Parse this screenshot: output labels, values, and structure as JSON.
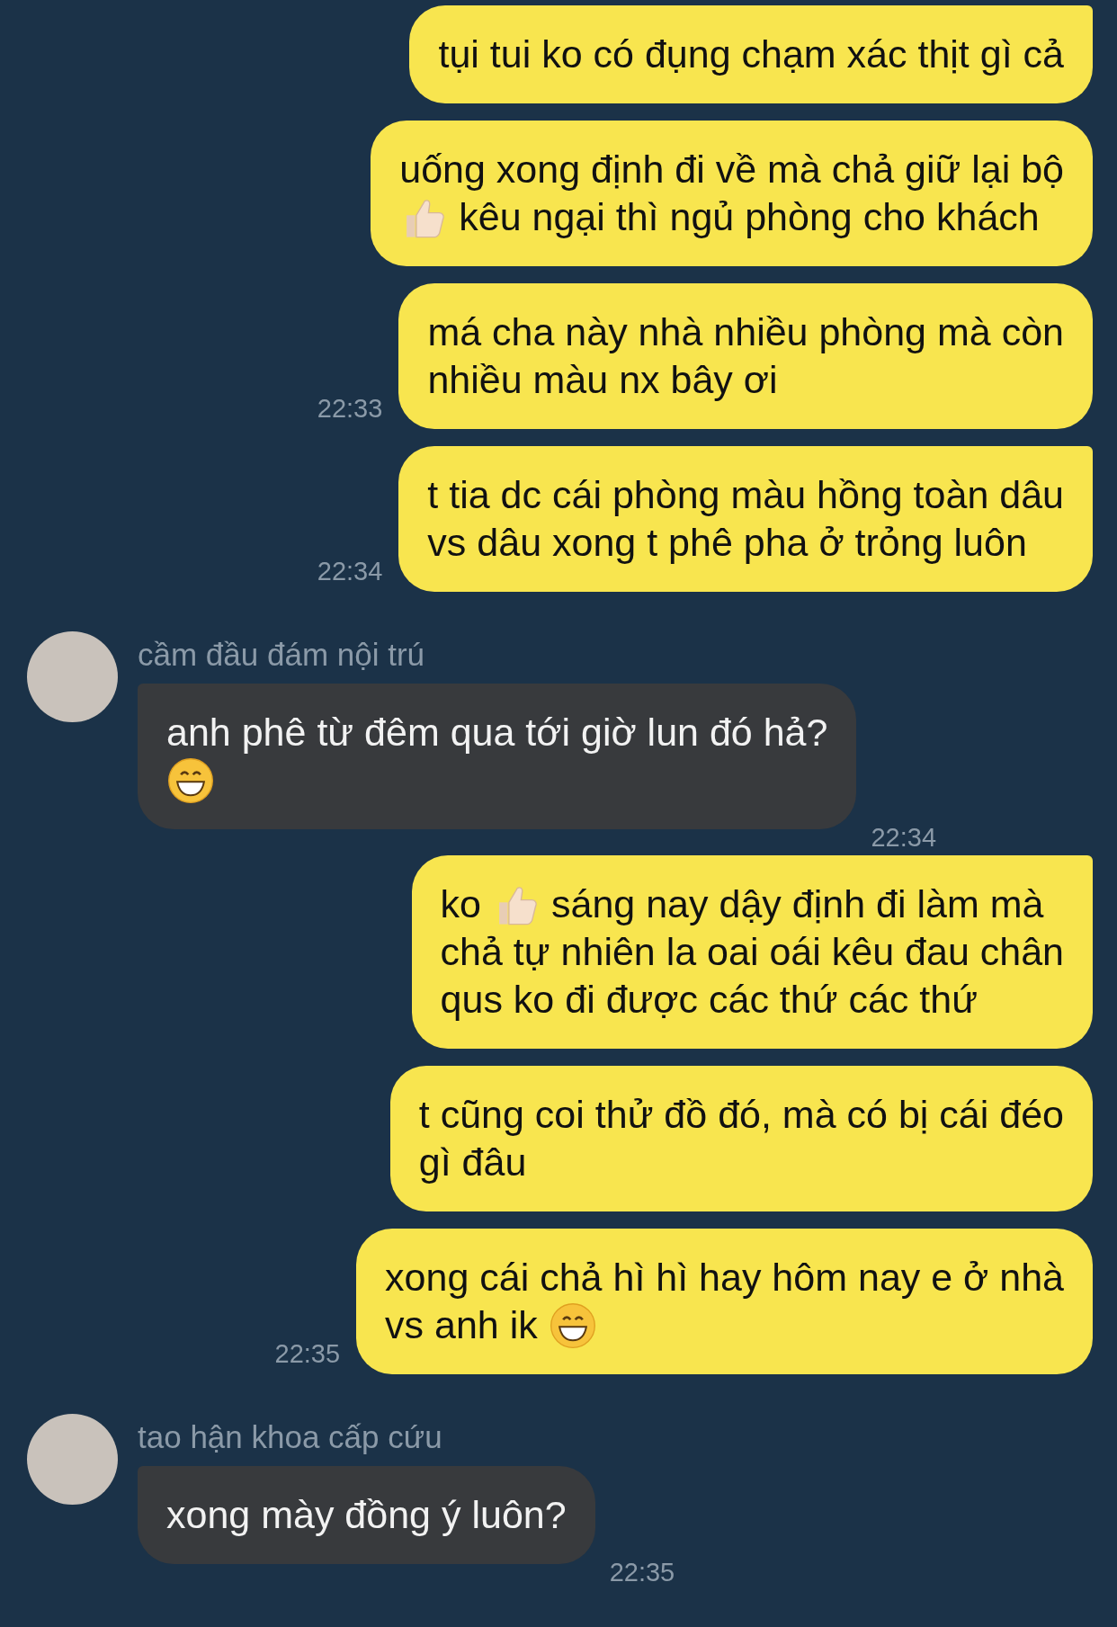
{
  "messages": [
    {
      "kind": "out",
      "tail": true,
      "lines": [
        [
          {
            "kind": "text",
            "text": "tụi tui ko có đụng chạm xác thịt gì cả"
          }
        ]
      ]
    },
    {
      "kind": "out",
      "tail": false,
      "lines": [
        [
          {
            "kind": "text",
            "text": "uống xong định đi về mà chả giữ lại bộ"
          }
        ],
        [
          {
            "kind": "thumbs"
          },
          {
            "kind": "text",
            "text": "kêu ngại thì ngủ phòng cho khách"
          }
        ]
      ]
    },
    {
      "kind": "out",
      "tail": false,
      "time": "22:33",
      "lines": [
        [
          {
            "kind": "text",
            "text": "má cha này nhà nhiều phòng mà còn"
          }
        ],
        [
          {
            "kind": "text",
            "text": "nhiều màu nx bây ơi"
          }
        ]
      ]
    },
    {
      "kind": "out",
      "tail": true,
      "time": "22:34",
      "lines": [
        [
          {
            "kind": "text",
            "text": "t tia dc cái phòng màu hồng toàn dâu"
          }
        ],
        [
          {
            "kind": "text",
            "text": "vs dâu xong t phê pha ở trỏng luôn"
          }
        ]
      ]
    },
    {
      "kind": "in",
      "sender": "cầm đầu đám nội trú",
      "time": "22:34",
      "lines": [
        [
          {
            "kind": "text",
            "text": "anh phê từ đêm qua tới giờ lun đó hả?"
          }
        ],
        [
          {
            "kind": "grin"
          }
        ]
      ]
    },
    {
      "kind": "out",
      "tail": true,
      "lines": [
        [
          {
            "kind": "text",
            "text": "ko"
          },
          {
            "kind": "thumbs"
          },
          {
            "kind": "text",
            "text": "sáng nay dậy định đi làm mà"
          }
        ],
        [
          {
            "kind": "text",
            "text": "chả tự nhiên la oai oái kêu đau chân"
          }
        ],
        [
          {
            "kind": "text",
            "text": "qus ko đi được các thứ các thứ"
          }
        ]
      ]
    },
    {
      "kind": "out",
      "tail": false,
      "lines": [
        [
          {
            "kind": "text",
            "text": "t cũng coi thử đồ đó, mà có bị cái đéo"
          }
        ],
        [
          {
            "kind": "text",
            "text": "gì đâu"
          }
        ]
      ]
    },
    {
      "kind": "out",
      "tail": false,
      "time": "22:35",
      "lines": [
        [
          {
            "kind": "text",
            "text": "xong cái chả hì hì hay hôm nay e ở nhà"
          }
        ],
        [
          {
            "kind": "text",
            "text": "vs anh ik"
          },
          {
            "kind": "grin"
          }
        ]
      ]
    },
    {
      "kind": "in",
      "sender": "tao hận khoa cấp cứu",
      "time": "22:35",
      "lines": [
        [
          {
            "kind": "text",
            "text": "xong mày đồng ý luôn?"
          }
        ]
      ]
    }
  ]
}
